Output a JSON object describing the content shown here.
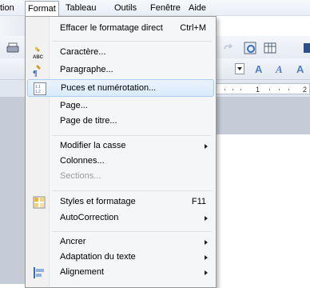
{
  "menubar": {
    "items": [
      {
        "label": "tion"
      },
      {
        "label": "Format"
      },
      {
        "label": "Tableau"
      },
      {
        "label": "Outils"
      },
      {
        "label": "Fenêtre"
      },
      {
        "label": "Aide"
      }
    ]
  },
  "ruler": {
    "numbers": [
      "1",
      "2"
    ]
  },
  "format_menu": {
    "items": [
      {
        "label": "Effacer le formatage direct",
        "shortcut": "Ctrl+M"
      },
      {
        "label": "Caractère...",
        "icon": "character-icon"
      },
      {
        "label": "Paragraphe...",
        "icon": "paragraph-icon"
      },
      {
        "label": "Puces et numérotation...",
        "icon": "bullets-numbering-icon"
      },
      {
        "label": "Page..."
      },
      {
        "label": "Page de titre..."
      },
      {
        "label": "Modifier la casse"
      },
      {
        "label": "Colonnes..."
      },
      {
        "label": "Sections..."
      },
      {
        "label": "Styles et formatage",
        "shortcut": "F11",
        "icon": "styles-formatting-icon"
      },
      {
        "label": "AutoCorrection"
      },
      {
        "label": "Ancrer"
      },
      {
        "label": "Adaptation du texte"
      },
      {
        "label": "Alignement",
        "icon": "alignment-icon"
      }
    ]
  },
  "colors": {
    "highlight": "#d9ebfb",
    "menu_bg": "#f5f6f7",
    "disabled": "#9a9a9a"
  }
}
